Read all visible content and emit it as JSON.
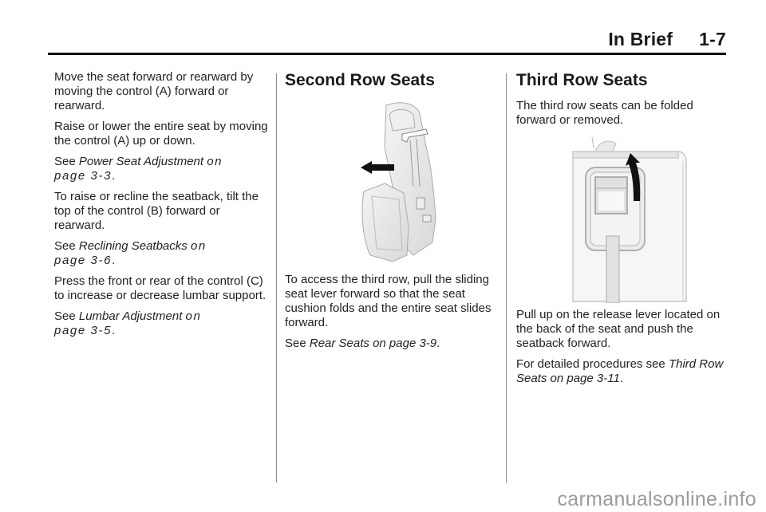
{
  "header": {
    "section": "In Brief",
    "page_number": "1-7"
  },
  "column1": {
    "paragraphs": [
      "Move the seat forward or rearward by moving the control (A) forward or rearward.",
      "Raise or lower the entire seat by moving the control (A) up or down."
    ],
    "see1": {
      "prefix": "See ",
      "link_text": "Power Seat Adjustment",
      "on": "on",
      "page": "page 3-3",
      "suffix": "."
    },
    "paragraph3": "To raise or recline the seatback, tilt the top of the control (B) forward or rearward.",
    "see2": {
      "prefix": "See ",
      "link_text": "Reclining Seatbacks",
      "on": "on",
      "page": "page 3-6",
      "suffix": "."
    },
    "paragraph4": "Press the front or rear of the control (C) to increase or decrease lumbar support.",
    "see3": {
      "prefix": "See ",
      "link_text": "Lumbar Adjustment",
      "on": "on",
      "page": "page 3-5",
      "suffix": "."
    }
  },
  "column2": {
    "heading": "Second Row Seats",
    "figure_icon": "second-row-seat-illustration",
    "paragraph": "To access the third row, pull the sliding seat lever forward so that the seat cushion folds and the entire seat slides forward.",
    "see": {
      "prefix": "See ",
      "link_text": "Rear Seats on page 3-9",
      "suffix": "."
    }
  },
  "column3": {
    "heading": "Third Row Seats",
    "intro": "The third row seats can be folded forward or removed.",
    "figure_icon": "third-row-release-lever-illustration",
    "paragraph": "Pull up on the release lever located on the back of the seat and push the seatback forward.",
    "see": {
      "prefix": "For detailed procedures see ",
      "link_text": "Third Row Seats on page 3-11",
      "suffix": "."
    }
  },
  "watermark": "carmanualsonline.info"
}
